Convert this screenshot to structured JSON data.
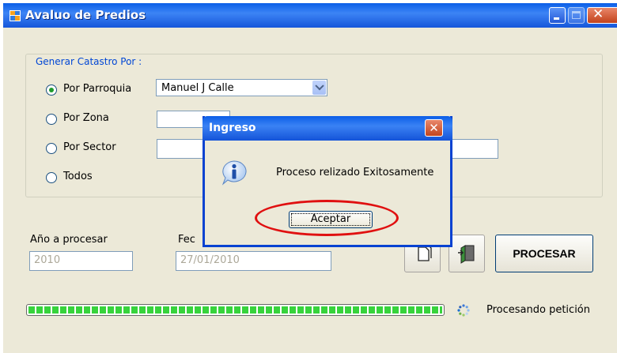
{
  "window": {
    "title": "Avaluo de Predios",
    "icon": "app-form-icon"
  },
  "group": {
    "legend": "Generar Catastro Por :",
    "options": [
      {
        "label": "Por Parroquia",
        "selected": true
      },
      {
        "label": "Por Zona",
        "selected": false
      },
      {
        "label": "Por Sector",
        "selected": false
      },
      {
        "label": "Todos",
        "selected": false
      }
    ],
    "parroquia_value": "Manuel J Calle",
    "zona_value": "",
    "sector_value": "",
    "sector_value2": ""
  },
  "anio": {
    "label": "Año a procesar",
    "value": "2010"
  },
  "fecha": {
    "label": "Fec",
    "value": "27/01/2010"
  },
  "buttons": {
    "procesar": "PROCESAR",
    "new_icon": "document-icon",
    "exit_icon": "exit-door-icon"
  },
  "progress": {
    "fraction": 1.0,
    "status": "Procesando petición"
  },
  "dialog": {
    "title": "Ingreso",
    "message": "Proceso relizado Exitosamente",
    "ok": "Aceptar",
    "icon": "info-icon"
  },
  "colors": {
    "titlebar": "#0a5fe7",
    "highlight": "#e01010",
    "progress": "#37d33c",
    "legend": "#0046d5"
  }
}
